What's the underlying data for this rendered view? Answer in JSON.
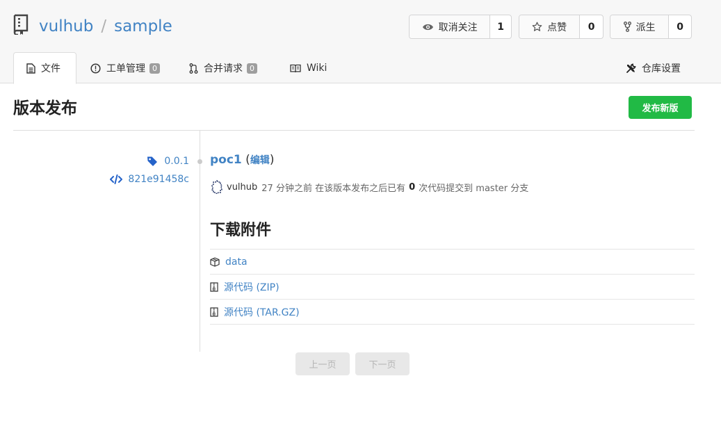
{
  "repo": {
    "owner": "vulhub",
    "separator": "/",
    "name": "sample"
  },
  "actions": {
    "watch": {
      "label": "取消关注",
      "count": "1"
    },
    "star": {
      "label": "点赞",
      "count": "0"
    },
    "fork": {
      "label": "派生",
      "count": "0"
    }
  },
  "tabs": {
    "files": {
      "label": "文件"
    },
    "issues": {
      "label": "工单管理",
      "badge": "0"
    },
    "pulls": {
      "label": "合并请求",
      "badge": "0"
    },
    "wiki": {
      "label": "Wiki"
    },
    "settings": {
      "label": "仓库设置"
    }
  },
  "page": {
    "title": "版本发布",
    "new_release_label": "发布新版"
  },
  "release": {
    "tag": "0.0.1",
    "commit": "821e91458c",
    "name": "poc1",
    "edit_label": "编辑",
    "author": "vulhub",
    "time_ago": "27 分钟之前",
    "since_text": "在该版本发布之后已有",
    "commit_count": "0",
    "commits_to": "次代码提交到 master 分支"
  },
  "downloads": {
    "title": "下载附件",
    "items": [
      {
        "label": "data",
        "icon": "package-icon"
      },
      {
        "label": "源代码 (ZIP)",
        "icon": "zip-file-icon"
      },
      {
        "label": "源代码 (TAR.GZ)",
        "icon": "zip-file-icon"
      }
    ]
  },
  "pagination": {
    "prev": "上一页",
    "next": "下一页"
  },
  "colors": {
    "link": "#4183c4",
    "primary_green": "#21ba45",
    "badge_grey": "#9e9e9e"
  }
}
